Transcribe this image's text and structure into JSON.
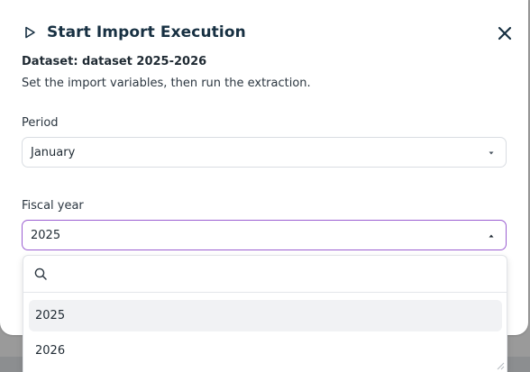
{
  "modal": {
    "title": "Start Import Execution",
    "dataset_line": "Dataset: dataset 2025-2026",
    "subtitle": "Set the import variables, then run the extraction."
  },
  "fields": {
    "period": {
      "label": "Period",
      "value": "January"
    },
    "fiscal_year": {
      "label": "Fiscal year",
      "value": "2025",
      "open": true,
      "search_placeholder": "",
      "options": [
        "2025",
        "2026"
      ],
      "highlighted_option": "2025"
    }
  },
  "colors": {
    "title": "#173042",
    "focus_border": "#9b5fd1",
    "option_hover": "#f1f2f4",
    "backdrop": "#9a9a9a"
  },
  "icons": {
    "title_icon": "play-icon",
    "close": "close-icon",
    "search": "search-icon",
    "caret_down": "chevron-down-icon",
    "caret_up": "chevron-up-icon"
  }
}
